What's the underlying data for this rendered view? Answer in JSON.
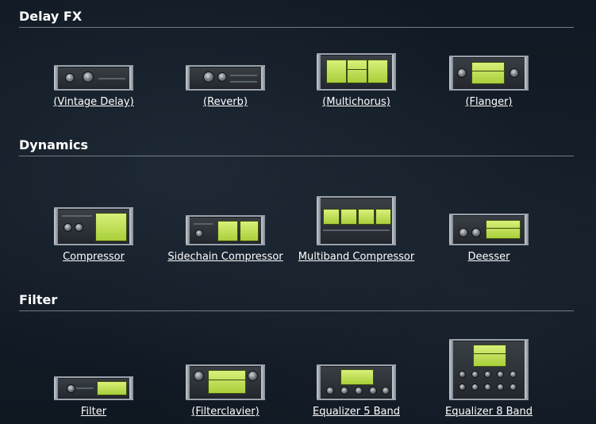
{
  "sections": [
    {
      "title": "Delay FX",
      "items": [
        {
          "label": "(Vintage Delay)",
          "thumb": "vintage-delay-thumbnail"
        },
        {
          "label": "(Reverb)",
          "thumb": "reverb-thumbnail"
        },
        {
          "label": "(Multichorus)",
          "thumb": "multichorus-thumbnail"
        },
        {
          "label": "(Flanger)",
          "thumb": "flanger-thumbnail"
        }
      ]
    },
    {
      "title": "Dynamics",
      "items": [
        {
          "label": "Compressor",
          "thumb": "compressor-thumbnail"
        },
        {
          "label": "Sidechain Compressor",
          "thumb": "sidechain-compressor-thumbnail"
        },
        {
          "label": "Multiband Compressor",
          "thumb": "multiband-compressor-thumbnail"
        },
        {
          "label": "Deesser",
          "thumb": "deesser-thumbnail"
        }
      ]
    },
    {
      "title": "Filter",
      "items": [
        {
          "label": "Filter",
          "thumb": "filter-thumbnail"
        },
        {
          "label": "(Filterclavier)",
          "thumb": "filterclavier-thumbnail"
        },
        {
          "label": "Equalizer 5 Band",
          "thumb": "equalizer-5-band-thumbnail"
        },
        {
          "label": "Equalizer 8 Band",
          "thumb": "equalizer-8-band-thumbnail"
        }
      ]
    }
  ],
  "colors": {
    "background": "#0e1620",
    "rule": "#8a949e",
    "lcd": "#c8e65a",
    "text": "#ffffff"
  }
}
